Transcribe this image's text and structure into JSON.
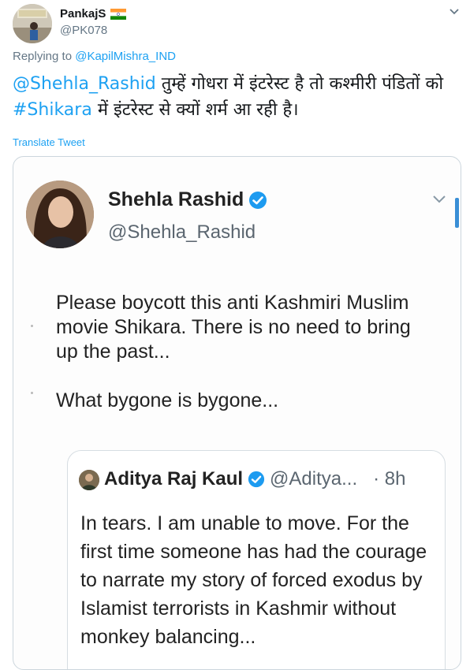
{
  "tweet": {
    "author_name": "PankajS",
    "author_handle": "@PK078",
    "replying_prefix": "Replying to ",
    "replying_to": "@KapilMishra_IND",
    "text_mention": "@Shehla_Rashid",
    "text_part1": " तुम्हें गोधरा में इंटरेस्ट है तो कश्मीरी पंडितों को ",
    "text_hashtag": "#Shikara",
    "text_part2": " में इंटरेस्ट से क्यों शर्म आ रही है।",
    "translate_label": "Translate Tweet",
    "icons": [
      "india-flag-icon",
      "chevron-down-icon"
    ]
  },
  "embedded": {
    "name": "Shehla Rashid",
    "handle": "@Shehla_Rashid",
    "body_p1": "Please boycott this anti Kashmiri Muslim movie Shikara. There is no need to bring up the past...",
    "body_p2": "What bygone is bygone...",
    "icons": [
      "verified-badge-icon",
      "chevron-down-icon"
    ]
  },
  "quoted": {
    "name": "Aditya Raj Kaul",
    "handle": "@Aditya...",
    "time": "· 8h",
    "text": "In tears. I am unable to move. For the first time someone has had the courage to narrate my story of forced exodus by Islamist terrorists in Kashmir without monkey balancing..."
  },
  "colors": {
    "link": "#1da1f2",
    "verified": "#1d9bf0",
    "muted": "#657786"
  }
}
